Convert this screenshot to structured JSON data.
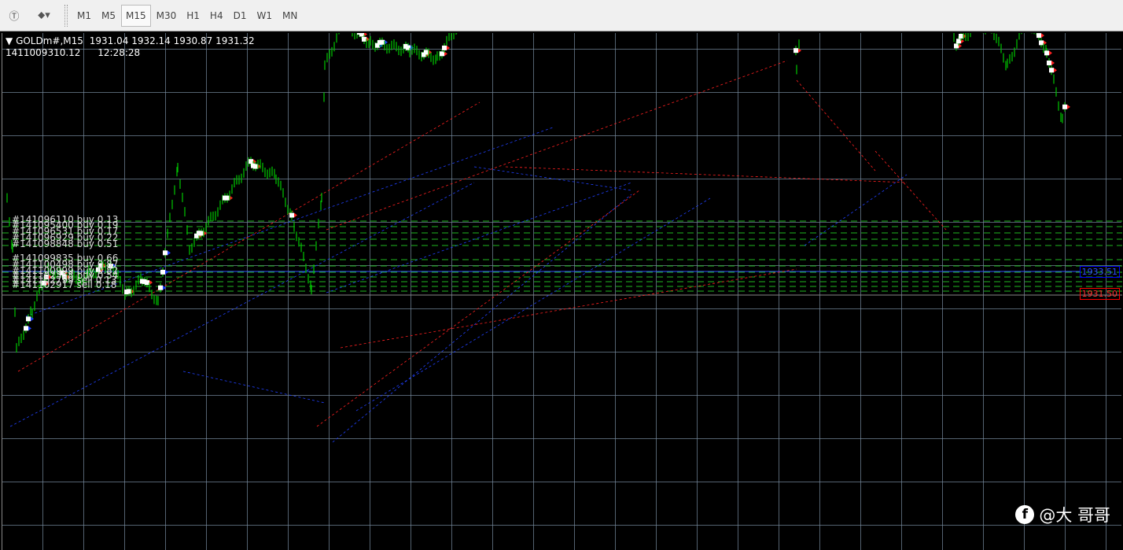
{
  "toolbar": {
    "timeframes": [
      "M1",
      "M5",
      "M15",
      "M30",
      "H1",
      "H4",
      "D1",
      "W1",
      "MN"
    ],
    "active": "M15"
  },
  "chart": {
    "symbol_line": "GOLDm#,M15",
    "ohlc": "1931.04 1932.14 1930.87 1931.32",
    "account": "1411009310.12",
    "time": "12:28:28",
    "ask_tag": "1933.51",
    "bid_tag": "1931.50",
    "ask_color": "#0000ff",
    "bid_color": "#ff0000",
    "bull_color": "#00c800",
    "grid_color": "#78909f"
  },
  "orders": [
    "#141096110 buy 0.13",
    "#141095400 buy 0.19",
    "#141096531 buy 0.17",
    "#141096929 buy 0.22",
    "#141098848 buy 0.51",
    "#141099835 buy 0.66",
    "#141100498 buy 0.87",
    "#141100999 buy 0.82",
    "#141102358 buy 0.54",
    "#141102799 sell 0.13",
    "#141102917 sell 0.18"
  ],
  "watermark": "@大 哥哥",
  "price_path": [
    [
      8,
      1939.6
    ],
    [
      15,
      1935.5
    ],
    [
      20,
      1926.8
    ],
    [
      40,
      1930.2
    ],
    [
      60,
      1933.6
    ],
    [
      100,
      1932.9
    ],
    [
      140,
      1934.2
    ],
    [
      160,
      1931.5
    ],
    [
      180,
      1932.9
    ],
    [
      200,
      1930.9
    ],
    [
      225,
      1942.6
    ],
    [
      240,
      1935.5
    ],
    [
      270,
      1938.2
    ],
    [
      318,
      1942.9
    ],
    [
      350,
      1941.6
    ],
    [
      370,
      1938.2
    ],
    [
      395,
      1932.2
    ],
    [
      408,
      1939.6
    ],
    [
      412,
      1951.0
    ],
    [
      435,
      1954.7
    ],
    [
      470,
      1953.0
    ],
    [
      520,
      1952.4
    ],
    [
      555,
      1951.7
    ],
    [
      580,
      1954.4
    ],
    [
      595,
      1959.8
    ],
    [
      607,
      1964.5
    ],
    [
      640,
      1960.5
    ],
    [
      670,
      1958.1
    ],
    [
      700,
      1962.5
    ],
    [
      740,
      1960.5
    ],
    [
      780,
      1960.1
    ],
    [
      798,
      1962.8
    ],
    [
      810,
      1957.1
    ],
    [
      830,
      1955.1
    ],
    [
      850,
      1957.1
    ],
    [
      875,
      1955.1
    ],
    [
      895,
      1959.8
    ],
    [
      920,
      1955.1
    ],
    [
      940,
      1956.4
    ],
    [
      975,
      1960.5
    ],
    [
      995,
      1968.5
    ],
    [
      1005,
      1960.5
    ],
    [
      1012,
      1951.0
    ],
    [
      1020,
      1956.4
    ],
    [
      1050,
      1957.1
    ],
    [
      1080,
      1955.7
    ],
    [
      1110,
      1962.1
    ],
    [
      1140,
      1961.8
    ],
    [
      1160,
      1958.4
    ],
    [
      1200,
      1956.4
    ],
    [
      1215,
      1953.0
    ],
    [
      1240,
      1954.4
    ],
    [
      1260,
      1954.4
    ],
    [
      1280,
      1951.0
    ],
    [
      1305,
      1955.1
    ],
    [
      1330,
      1952.4
    ],
    [
      1350,
      1946.3
    ],
    [
      1355,
      1948.3
    ]
  ]
}
